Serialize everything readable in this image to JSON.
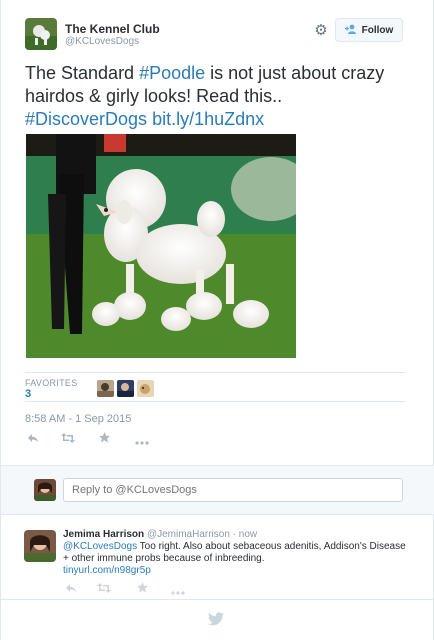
{
  "tweet": {
    "author_name": "The Kennel Club",
    "author_handle": "@KCLovesDogs",
    "follow_label": "Follow",
    "text_part1": "The Standard ",
    "text_hashtag1": "#Poodle",
    "text_part2": " is not just about crazy hairdos & girly looks! Read this..",
    "text_hashtag2": "#DiscoverDogs",
    "text_link": "bit.ly/1huZdnx",
    "favorites_label": "FAVORITES",
    "favorites_count": "3",
    "timestamp": "8:58 AM - 1 Sep 2015"
  },
  "reply_box": {
    "placeholder": "Reply to @KCLovesDogs"
  },
  "reply": {
    "author_name": "Jemima Harrison",
    "author_handle": "@JemimaHarrison",
    "separator": "·",
    "time": "now",
    "mention": "@KCLovesDogs",
    "text": "  Too right. Also about sebaceous adenitis, Addison's Disease + other immune probs because of inbreeding.",
    "link": "tinyurl.com/n98gr5p"
  },
  "icons": {
    "gear": "gear-icon",
    "follow": "add-user-icon",
    "reply": "reply-icon",
    "retweet": "retweet-icon",
    "favorite": "star-icon",
    "more": "more-icon",
    "footer": "twitter-bird-icon"
  },
  "colors": {
    "link": "#2b7bb9",
    "muted": "#8899a6",
    "accent": "#55acee"
  }
}
